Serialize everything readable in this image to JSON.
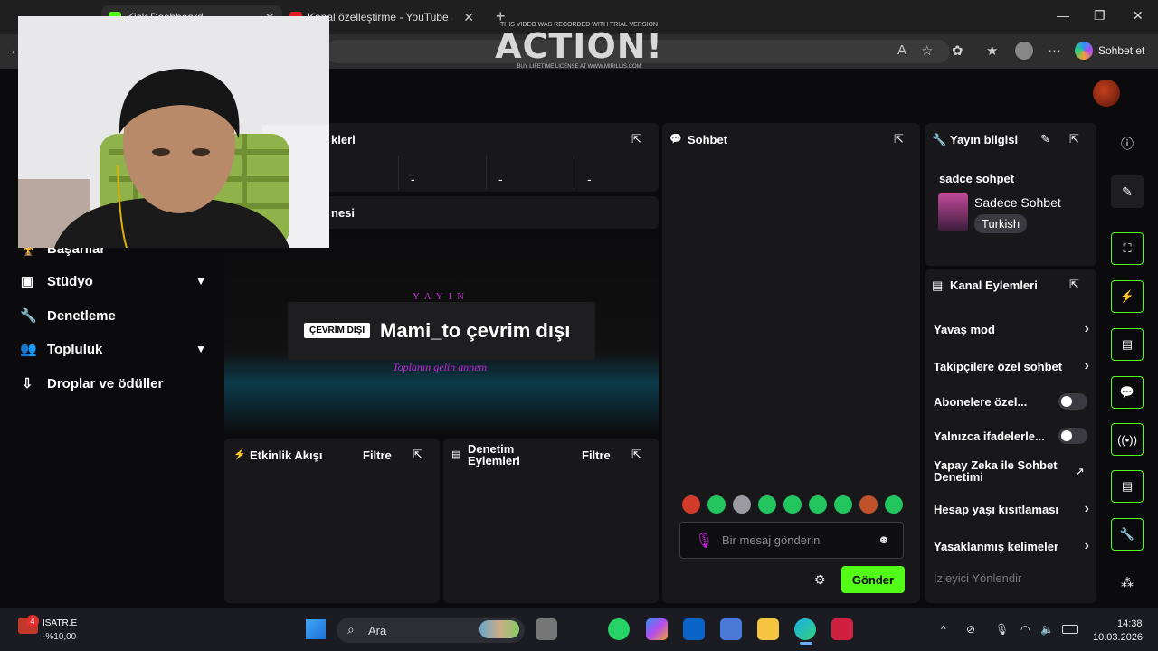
{
  "browser": {
    "active_tab_title": "Kick Dashboard",
    "second_tab_title": "Kanal özelleştirme - YouTube Studio",
    "copilot_label": "Sohbet et"
  },
  "watermark": {
    "top": "THIS VIDEO WAS RECORDED WITH TRIAL VERSION",
    "logo": "ACTION!",
    "bottom": "BUY LIFETIME LICENSE AT WWW.MIRILLIS.COM"
  },
  "nav": [
    {
      "label": "Başarılar",
      "icon": "trophy-icon"
    },
    {
      "label": "Stüdyo",
      "icon": "studio-icon",
      "expandable": true
    },
    {
      "label": "Denetleme",
      "icon": "wrench-icon"
    },
    {
      "label": "Topluluk",
      "icon": "community-icon",
      "expandable": true
    },
    {
      "label": "Droplar ve ödüller",
      "icon": "drops-icon"
    }
  ],
  "stats_panel": {
    "title_partial": "kleri",
    "cells": [
      "-",
      "-",
      "-"
    ]
  },
  "player_panel": {
    "title_partial": "nesi",
    "overlay_title": "YAYIN",
    "overlay_subtitle": "Toplanın gelin annem",
    "offline_badge": "ÇEVRİM DIŞI",
    "offline_text": "Mami_to çevrim dışı"
  },
  "activity_panel": {
    "title": "Etkinlik Akışı",
    "filter": "Filtre"
  },
  "moderation_panel": {
    "title": "Denetim Eylemleri",
    "filter": "Filtre"
  },
  "chat": {
    "title": "Sohbet",
    "placeholder": "Bir mesaj gönderin",
    "send": "Gönder"
  },
  "stream_info": {
    "title": "Yayın bilgisi",
    "stream_title": "sadce sohpet",
    "category": "Sadece Sohbet",
    "language": "Turkish"
  },
  "channel_actions": {
    "title": "Kanal Eylemleri",
    "rows": [
      {
        "label": "Yavaş mod",
        "type": "arrow"
      },
      {
        "label": "Takipçilere özel sohbet",
        "type": "arrow"
      },
      {
        "label": "Abonelere özel...",
        "type": "toggle",
        "on": false
      },
      {
        "label": "Yalnızca ifadelerle...",
        "type": "toggle",
        "on": false
      },
      {
        "label": "Yapay Zeka ile Sohbet Denetimi",
        "type": "external"
      },
      {
        "label": "Hesap yaşı kısıtlaması",
        "type": "arrow"
      },
      {
        "label": "Yasaklanmış kelimeler",
        "type": "arrow"
      }
    ],
    "faded_row": "İzleyici Yönlendir"
  },
  "taskbar": {
    "stock_name": "ISATR.E",
    "stock_change": "-%10,00",
    "stock_badge": "4",
    "search_placeholder": "Ara",
    "time": "14:38",
    "date": "10.03.2026"
  },
  "colors": {
    "accent": "#53fc18",
    "panel": "#18181b",
    "background": "#0b0b0d",
    "magenta": "#c026d3"
  }
}
